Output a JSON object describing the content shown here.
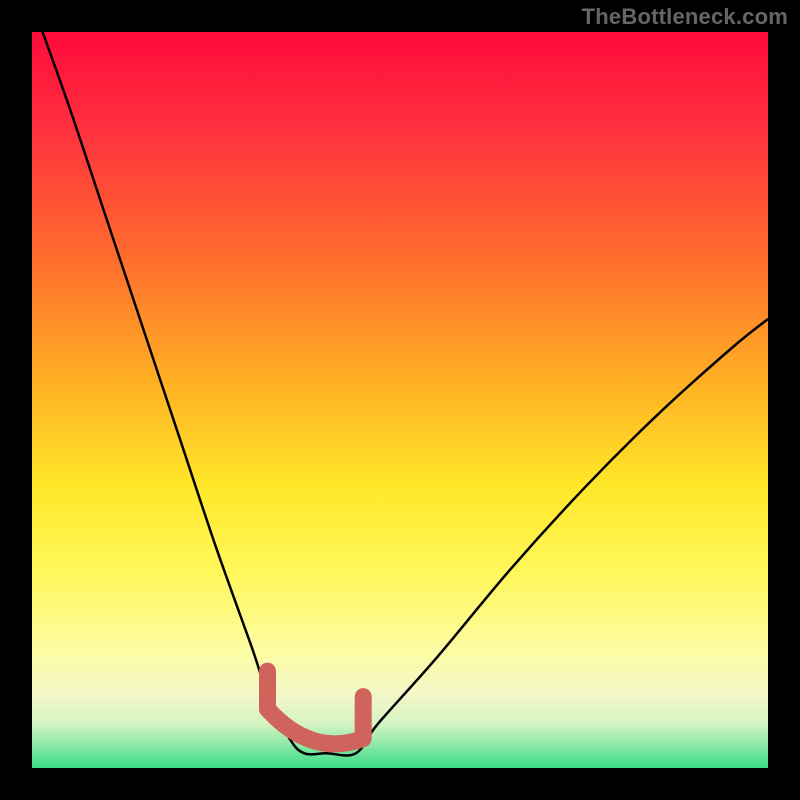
{
  "attribution": "TheBottleneck.com",
  "gradient": {
    "top_color": "#ff0a3b",
    "mid_upper_color": "#ff6a2e",
    "mid_color": "#ffe829",
    "mid_lower_color": "#fdfca3",
    "bottom_color": "#3bdc88"
  },
  "curve_style": {
    "stroke": "#000000",
    "stroke_width": 2.5,
    "marker_stroke": "#d0635b",
    "marker_stroke_width": 17
  },
  "chart_data": {
    "type": "line",
    "title": "",
    "xlabel": "",
    "ylabel": "",
    "xlim": [
      0,
      100
    ],
    "ylim": [
      0,
      100
    ],
    "grid": false,
    "legend": false,
    "series": [
      {
        "name": "bottleneck-curve",
        "x": [
          0,
          5,
          10,
          15,
          20,
          25,
          30,
          32,
          35,
          37,
          40,
          44,
          47,
          55,
          65,
          75,
          85,
          95,
          100
        ],
        "values": [
          104,
          90,
          75,
          60,
          45,
          30,
          16,
          10,
          4,
          2,
          2,
          2,
          6,
          15,
          27,
          38,
          48,
          57,
          61
        ]
      }
    ],
    "markers": [
      {
        "name": "left-dip-edge",
        "x": 32,
        "y": 8
      },
      {
        "name": "flat-bottom",
        "x": 38,
        "y": 2
      },
      {
        "name": "right-dip-edge",
        "x": 45,
        "y": 4
      }
    ],
    "note": "Values are estimated from pixel positions; x and y are percent of plot width/height measured from bottom-left."
  }
}
